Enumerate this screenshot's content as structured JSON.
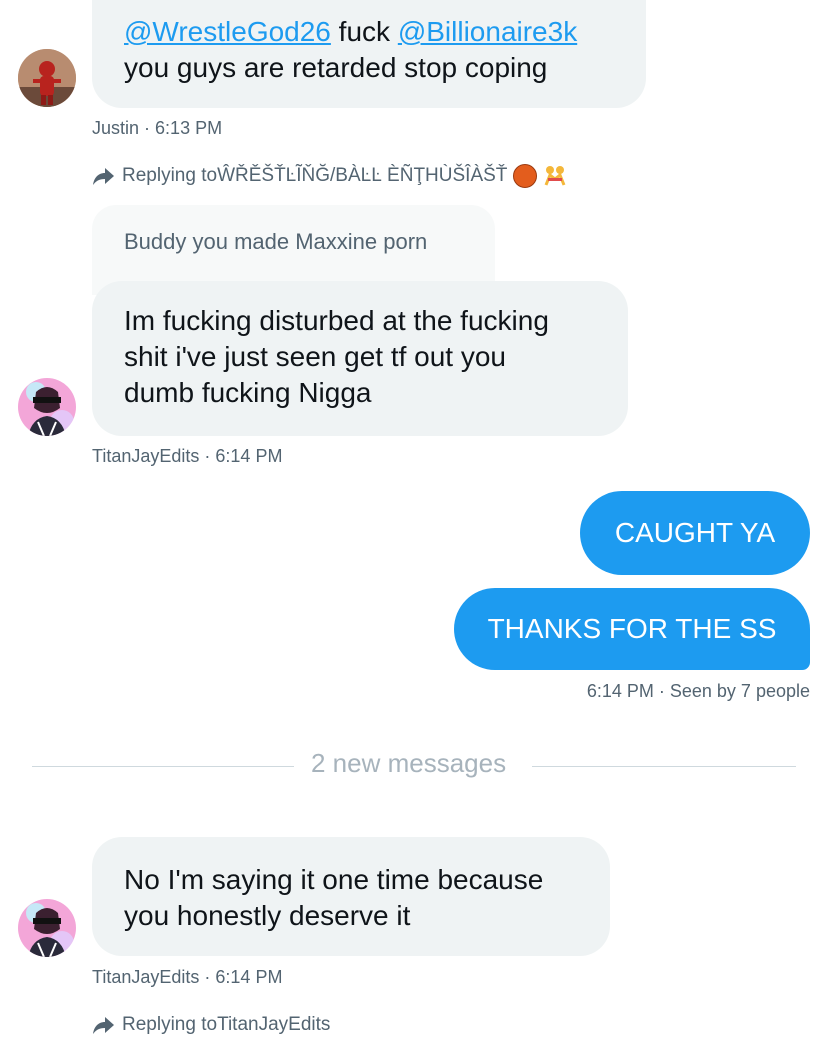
{
  "messages": {
    "m1": {
      "mention1": "@WrestleGod26",
      "middle": " fuck ",
      "mention2": "@Billionaire3k",
      "line2": "you guys are retarded stop coping",
      "sender": "Justin",
      "time": "6:13 PM"
    },
    "m2": {
      "reply_prefix": "Replying to ",
      "reply_to": "ŴŘĚŠŤĿĨŇĞ/BÀĿĿ ÈÑŢHÙŠÎÀŠŤ",
      "emoji1": "basketball-emoji",
      "emoji2": "wrestlers-emoji",
      "quoted": "Buddy you made Maxxine porn",
      "line1": "Im fucking disturbed at the fucking",
      "line2": "shit i've just seen get tf out you",
      "line3": "dumb fucking Nigga",
      "sender": "TitanJayEdits",
      "time": "6:14 PM"
    },
    "out1": "CAUGHT YA",
    "out2": "THANKS FOR THE SS",
    "out_time": "6:14 PM",
    "seen": "Seen by 7 people",
    "divider": "2 new messages",
    "m3": {
      "line1": "No I'm saying it one time because",
      "line2": "you honestly deserve it",
      "sender": "TitanJayEdits",
      "time": "6:14 PM"
    },
    "m4": {
      "reply_prefix": "Replying to ",
      "reply_to": "TitanJayEdits"
    }
  },
  "colors": {
    "accent": "#1d9bf0",
    "bubble_in": "#eff3f4",
    "meta_text": "#536471"
  }
}
